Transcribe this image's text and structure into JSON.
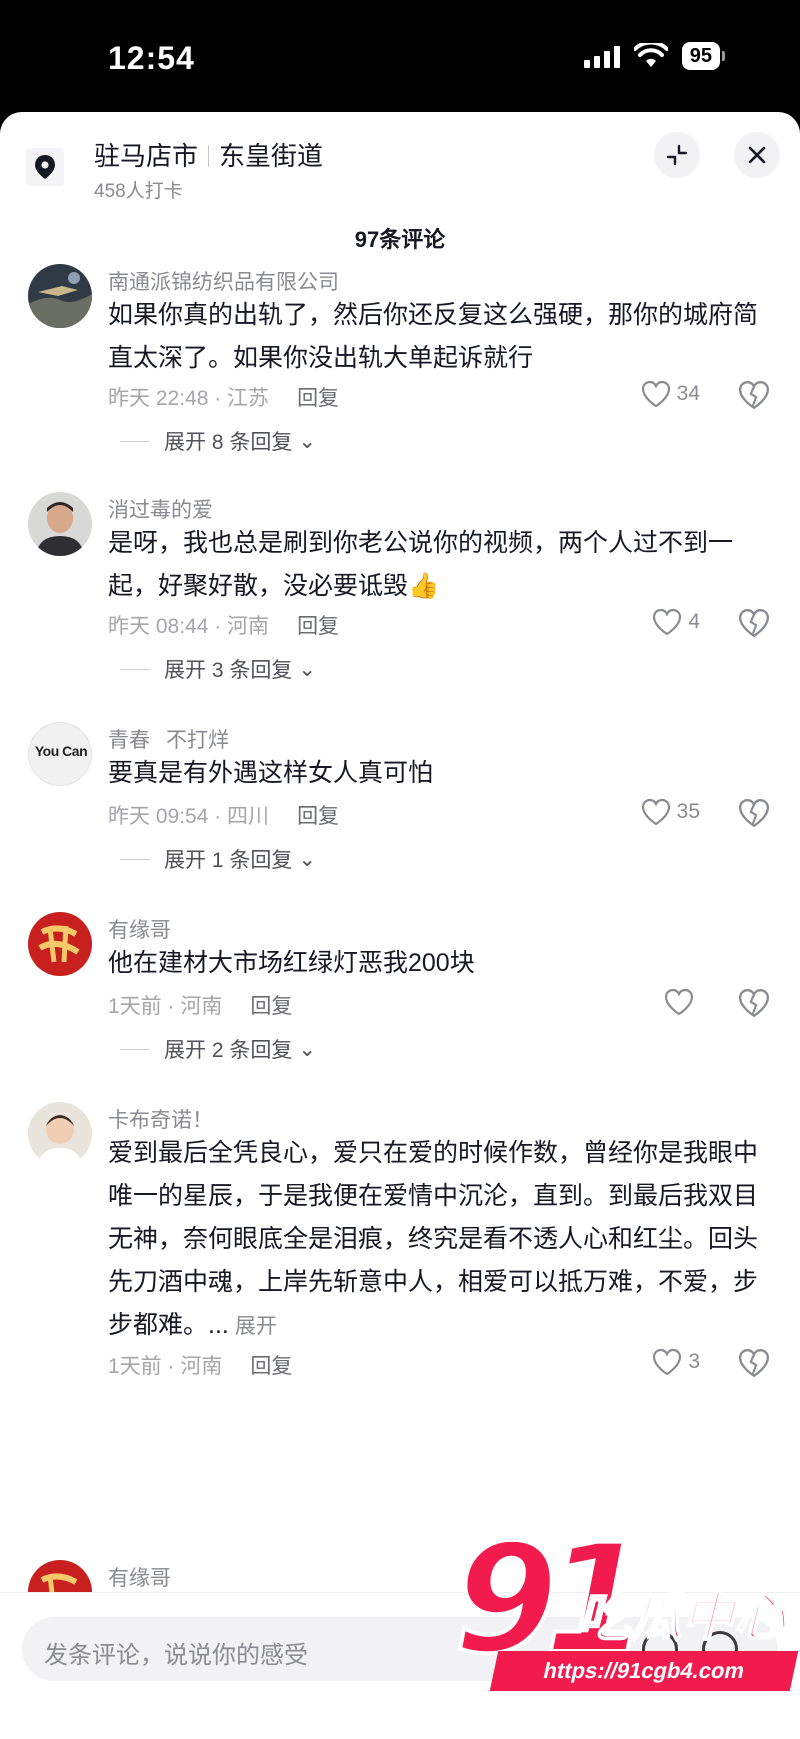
{
  "status_bar": {
    "time": "12:54",
    "battery": "95"
  },
  "location": {
    "city": "驻马店市",
    "street": "东皇街道",
    "checkins": "458人打卡"
  },
  "comment_count": "97条评论",
  "comments": [
    {
      "user": "南通派锦纺织品有限公司",
      "text": "如果你真的出轨了，然后你还反复这么强硬，那你的城府简直太深了。如果你没出轨大单起诉就行",
      "time_loc": "昨天 22:48 · 江苏",
      "reply": "回复",
      "likes": "34",
      "expand": "展开 8 条回复"
    },
    {
      "user": "消过毒的爱",
      "text": "是呀，我也总是刷到你老公说你的视频，两个人过不到一起，好聚好散，没必要诋毁👍",
      "time_loc": "昨天 08:44 · 河南",
      "reply": "回复",
      "likes": "4",
      "expand": "展开 3 条回复"
    },
    {
      "user": "青春",
      "user_extra": "不打烊",
      "avatar_text": "You Can",
      "text": "要真是有外遇这样女人真可怕",
      "time_loc": "昨天 09:54 · 四川",
      "reply": "回复",
      "likes": "35",
      "expand": "展开 1 条回复"
    },
    {
      "user": "有缘哥",
      "text": "他在建材大市场红绿灯恶我200块",
      "time_loc": "1天前 · 河南",
      "reply": "回复",
      "likes": "",
      "expand": "展开 2 条回复"
    },
    {
      "user": "卡布奇诺！",
      "text": "爱到最后全凭良心，爱只在爱的时候作数，曾经你是我眼中唯一的星辰，于是我便在爱情中沉沦，直到。到最后我双目无神，奈何眼底全是泪痕，终究是看不透人心和红尘。回头先刀酒中魂，上岸先斩意中人，相爱可以抵万难，不爱，步步都难。...",
      "more": "展开",
      "time_loc": "1天前 · 河南",
      "reply": "回复",
      "likes": "3"
    },
    {
      "user": "有缘哥"
    }
  ],
  "input": {
    "placeholder": "发条评论，说说你的感受"
  },
  "watermark": {
    "number": "91",
    "brand": "吃瓜中心",
    "url": "https://91cgb4.com"
  },
  "colors": {
    "accent": "#f21b4d",
    "muted": "#8a8b91",
    "text": "#161823"
  }
}
